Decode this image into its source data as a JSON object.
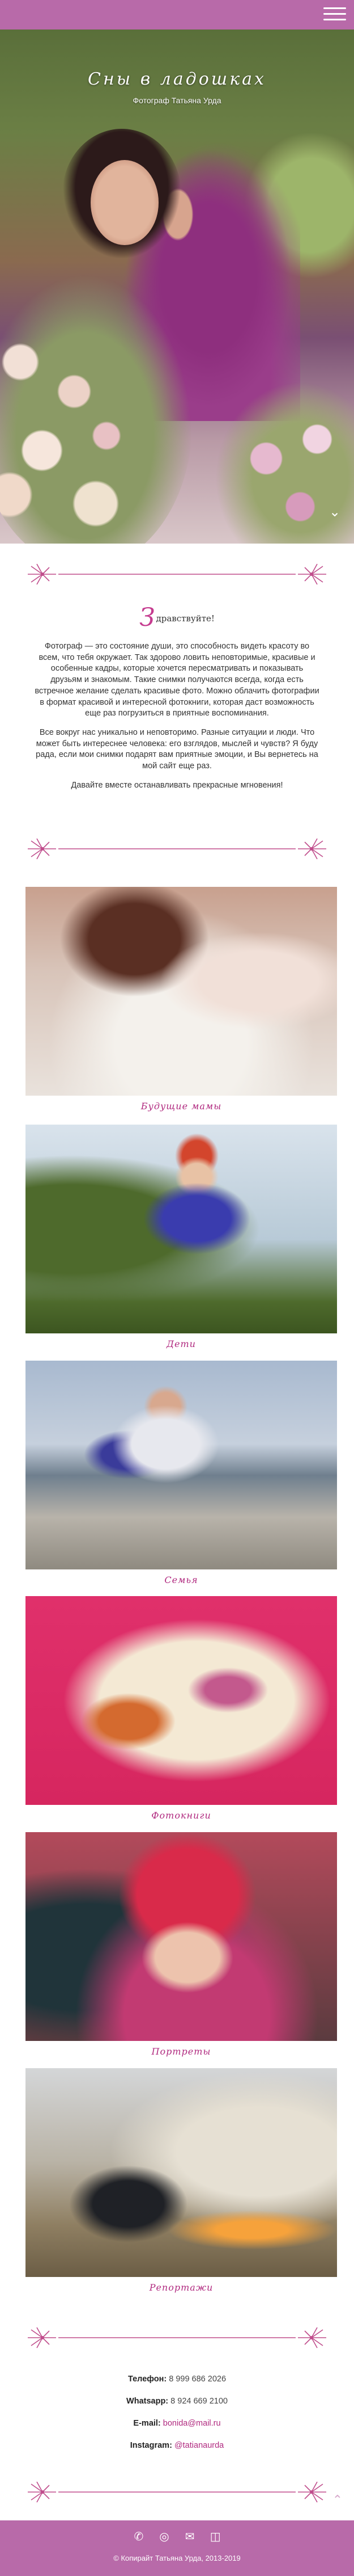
{
  "header": {
    "menu_icon": "hamburger-menu-icon"
  },
  "hero": {
    "title": "Сны в ладошках",
    "subtitle": "Фотограф Татьяна Урда"
  },
  "intro": {
    "greeting_initial": "З",
    "greeting_rest": "дравствуйте!",
    "p1": "Фотограф — это состояние души, это способность видеть красоту во всем, что тебя окружает. Так здорово ловить неповторимые, красивые и особенные кадры, которые хочется пересматривать и показывать друзьям и знакомым. Такие снимки получаются всегда, когда есть встречное желание сделать красивые фото. Можно облачить фотографии в формат красивой и интересной фотокниги, которая даст возможность еще раз погрузиться в приятные воспоминания.",
    "p2": "Все вокруг нас уникально и неповторимо. Разные ситуации и люди. Что может быть интереснее человека: его взглядов, мыслей и чувств? Я буду рада, если мои снимки подарят вам приятные эмоции, и Вы вернетесь на мой сайт еще раз.",
    "p3": "Давайте вместе останавливать прекрасные мгновения!"
  },
  "gallery": [
    {
      "caption": "Будущие мамы"
    },
    {
      "caption": "Дети"
    },
    {
      "caption": "Семья"
    },
    {
      "caption": "Фотокниги"
    },
    {
      "caption": "Портреты"
    },
    {
      "caption": "Репортажи"
    }
  ],
  "contacts": {
    "phone_label": "Телефон:",
    "phone": "8 999 686 2026",
    "whatsapp_label": "Whatsapp:",
    "whatsapp": "8 924 669 2100",
    "email_label": "E-mail:",
    "email": "bonida@mail.ru",
    "instagram_label": "Instagram:",
    "instagram": "@tatianaurda"
  },
  "footer": {
    "icons": [
      "phone-icon",
      "whatsapp-icon",
      "email-icon",
      "instagram-icon"
    ],
    "copyright": "© Копирайт Татьяна Урда, 2013-2019"
  },
  "colors": {
    "accent": "#b86aa9",
    "caption": "#b0297f",
    "ornament": "#c04d8c"
  }
}
